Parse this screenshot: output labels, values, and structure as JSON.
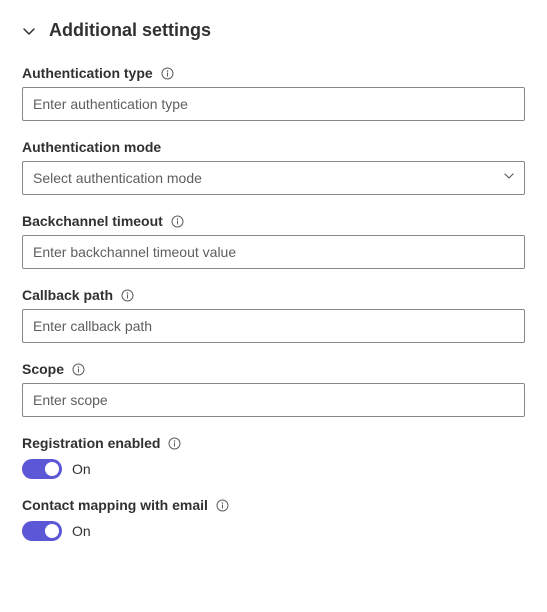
{
  "section": {
    "title": "Additional settings"
  },
  "fields": {
    "auth_type": {
      "label": "Authentication type",
      "placeholder": "Enter authentication type"
    },
    "auth_mode": {
      "label": "Authentication mode",
      "placeholder": "Select authentication mode"
    },
    "backchannel_timeout": {
      "label": "Backchannel timeout",
      "placeholder": "Enter backchannel timeout value"
    },
    "callback_path": {
      "label": "Callback path",
      "placeholder": "Enter callback path"
    },
    "scope": {
      "label": "Scope",
      "placeholder": "Enter scope"
    },
    "registration_enabled": {
      "label": "Registration enabled",
      "state_label": "On"
    },
    "contact_mapping": {
      "label": "Contact mapping with email",
      "state_label": "On"
    }
  }
}
